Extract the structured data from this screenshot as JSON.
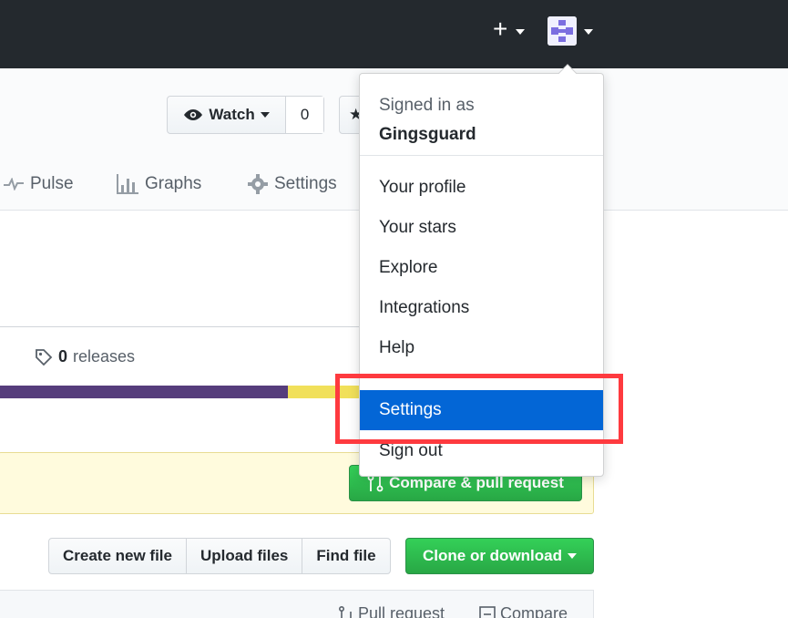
{
  "header": {
    "plus_icon": "plus-icon",
    "avatar_icon": "identicon-avatar"
  },
  "repo_actions": {
    "watch_label": "Watch",
    "watch_count": "0"
  },
  "tabs": {
    "pulse": "Pulse",
    "graphs": "Graphs",
    "settings": "Settings"
  },
  "summary": {
    "releases_count": "0",
    "releases_label": "releases"
  },
  "language_bar": {
    "colors": [
      "#563d7c",
      "#f1e05a"
    ],
    "fractions": [
      0.73,
      0.27
    ]
  },
  "compare": {
    "label": "Compare & pull request"
  },
  "file_actions": {
    "create": "Create new file",
    "upload": "Upload files",
    "find": "Find file",
    "clone": "Clone or download"
  },
  "bottom": {
    "pull_request": "Pull request",
    "compare": "Compare"
  },
  "dropdown": {
    "signed_in_as": "Signed in as",
    "username": "Gingsguard",
    "items": [
      "Your profile",
      "Your stars",
      "Explore",
      "Integrations",
      "Help",
      "Settings",
      "Sign out"
    ],
    "active": "Settings"
  },
  "colors": {
    "header_bg": "#24292e",
    "active_item": "#0366d6",
    "highlight": "#fe3a3f",
    "green": "#28a745"
  }
}
